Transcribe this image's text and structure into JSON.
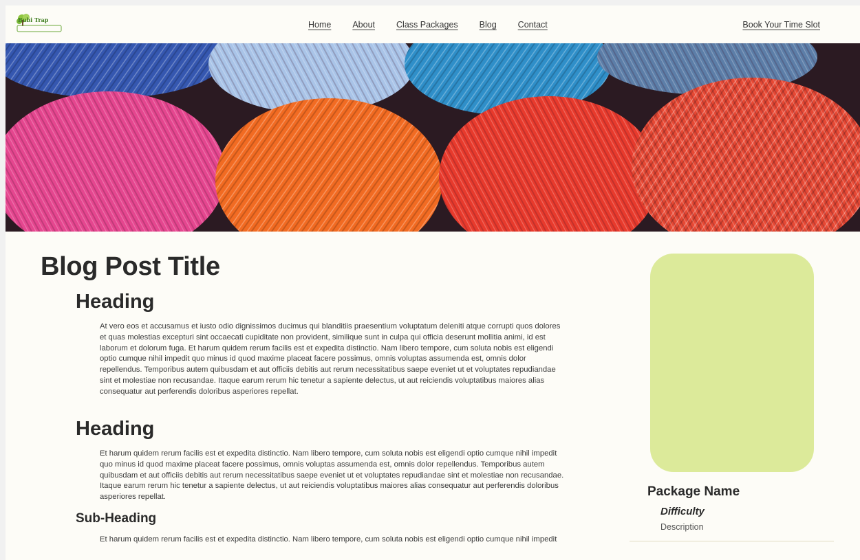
{
  "header": {
    "logo_text": "Bubi Trap",
    "nav": [
      "Home",
      "About",
      "Class Packages",
      "Blog",
      "Contact"
    ],
    "cta_label": "Book Your Time Slot"
  },
  "colors": {
    "page_background": "#fdfcf7",
    "card_image": "#dcea9a",
    "logo_green": "#3f7d1f"
  },
  "hero": {
    "icon": "yarn-balls-image"
  },
  "post": {
    "title": "Blog Post Title",
    "sections": [
      {
        "heading": "Heading",
        "body": "At vero eos et accusamus et iusto odio dignissimos ducimus qui  blanditiis praesentium voluptatum deleniti atque corrupti quos dolores  et quas molestias excepturi sint occaecati cupiditate non provident,  similique sunt in culpa qui officia deserunt mollitia animi,  id est  laborum et dolorum fuga. Et harum quidem rerum facilis est et expedita  distinctio. Nam libero tempore, cum soluta nobis est eligendi optio  cumque nihil impedit quo minus id quod maxime placeat facere possimus,  omnis voluptas assumenda est, omnis dolor repellendus. Temporibus autem  quibusdam et aut officiis debitis aut rerum necessitatibus saepe eveniet ut et voluptates repudiandae sint et molestiae non recusandae. Itaque  earum rerum hic tenetur a sapiente delectus, ut aut reiciendis  voluptatibus maiores alias consequatur aut perferendis doloribus  asperiores repellat."
      },
      {
        "heading": "Heading",
        "body": "Et harum quidem rerum facilis est et expedita  distinctio. Nam libero tempore, cum soluta nobis est eligendi optio  cumque nihil impedit quo minus id quod maxime placeat facere possimus,  omnis voluptas assumenda est, omnis dolor repellendus. Temporibus autem  quibusdam et aut officiis debitis aut rerum necessitatibus saepe eveniet ut et voluptates repudiandae sint et molestiae non recusandae. Itaque  earum rerum hic tenetur a sapiente delectus, ut aut reiciendis  voluptatibus maiores alias consequatur aut perferendis doloribus  asperiores repellat."
      }
    ],
    "subheading": "Sub-Heading",
    "subheading_body": "Et harum quidem rerum facilis est et expedita  distinctio. Nam libero tempore, cum soluta nobis est eligendi optio  cumque nihil impedit"
  },
  "package": {
    "name": "Package Name",
    "difficulty": "Difficulty",
    "description": "Description"
  }
}
